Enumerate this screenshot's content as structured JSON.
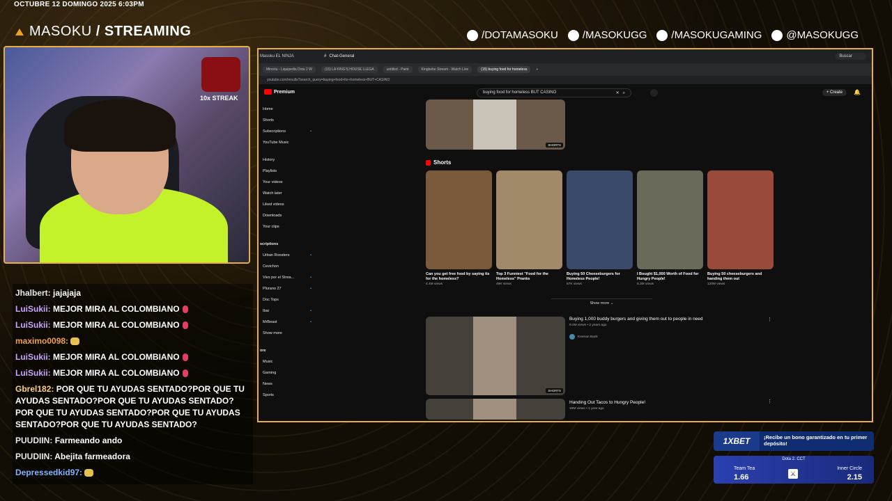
{
  "overlay": {
    "datetime": "OCTUBRE 12 DOMINGO 2025 6:03PM",
    "brand_name": "MASOKU",
    "brand_suffix": " / STREAMING",
    "socials": [
      {
        "icon": "facebook-icon",
        "label": "/DOTAMASOKU"
      },
      {
        "icon": "instagram-icon",
        "label": "/MASOKUGG"
      },
      {
        "icon": "youtube-icon",
        "label": "/MASOKUGAMING"
      },
      {
        "icon": "tiktok-icon",
        "label": "@MASOKUGG"
      }
    ],
    "streak": "10x STREAK"
  },
  "chat": [
    {
      "user": "Jhalbert:",
      "color": "#e8e8e8",
      "text": "jajajaja"
    },
    {
      "user": "LuiSukii:",
      "color": "#c8a6ff",
      "text": "MEJOR MIRA AL COLOMBIANO"
    },
    {
      "user": "LuiSukii:",
      "color": "#c8a6ff",
      "text": "MEJOR MIRA AL COLOMBIANO"
    },
    {
      "user": "maximo0098:",
      "color": "#f0a050",
      "text": ""
    },
    {
      "user": "LuiSukii:",
      "color": "#c8a6ff",
      "text": "MEJOR MIRA AL COLOMBIANO"
    },
    {
      "user": "LuiSukii:",
      "color": "#c8a6ff",
      "text": "MEJOR MIRA AL COLOMBIANO"
    },
    {
      "user": "Gbrel182:",
      "color": "#ffd080",
      "text": "POR QUE TU AYUDAS SENTADO?POR QUE TU AYUDAS SENTADO?POR QUE TU AYUDAS SENTADO?POR QUE TU AYUDAS SENTADO?POR QUE TU AYUDAS SENTADO?POR QUE TU AYUDAS SENTADO?"
    },
    {
      "user": "PUUDIIN:",
      "color": "#e8e8e8",
      "text": "Farmeando ando"
    },
    {
      "user": "PUUDIIN:",
      "color": "#e8e8e8",
      "text": "Abejita farmeadora"
    },
    {
      "user": "Depressedkid97:",
      "color": "#7fb2ff",
      "text": ""
    }
  ],
  "browser": {
    "window_title": "Masoku EL NINJA",
    "channel": "Chat-General",
    "tabs": [
      "Minoriu - Liquipedia Dota 2 W",
      "(15) LA KING'S HOUSE LLEGA",
      "untitled - Paint",
      "Kingbebe Stream - Watch Live",
      "(15) buying food for homeless"
    ],
    "search_placeholder": "Buscar",
    "url": "youtube.com/results?search_query=buying+food+for+homeless+BUT+CASINO"
  },
  "youtube": {
    "logo": "Premium",
    "query": "buying food for homeless BUT CASINO",
    "create_label": "Create",
    "sidebar": [
      {
        "label": "Home",
        "dot": false
      },
      {
        "label": "Shorts",
        "dot": false
      },
      {
        "label": "Subscriptions",
        "dot": true
      },
      {
        "label": "YouTube Music",
        "dot": false
      },
      {
        "gap": true
      },
      {
        "label": "History",
        "dot": false
      },
      {
        "label": "Playlists",
        "dot": false
      },
      {
        "label": "Your videos",
        "dot": false
      },
      {
        "label": "Watch later",
        "dot": false
      },
      {
        "label": "Liked videos",
        "dot": false
      },
      {
        "label": "Downloads",
        "dot": false
      },
      {
        "label": "Your clips",
        "dot": false
      },
      {
        "gap": true
      },
      {
        "label": "scriptions",
        "dot": false,
        "header": true
      },
      {
        "label": "Urban Roosters",
        "dot": true
      },
      {
        "label": "Cevichon",
        "dot": false
      },
      {
        "label": "Vivo por el Strea...",
        "dot": true
      },
      {
        "label": "Plurano 27",
        "dot": true
      },
      {
        "label": "Doc Tops",
        "dot": false
      },
      {
        "label": "Ibai",
        "dot": true
      },
      {
        "label": "MrBeast",
        "dot": true
      },
      {
        "label": "Show more",
        "dot": false
      },
      {
        "gap": true
      },
      {
        "label": "ore",
        "dot": false,
        "header": true
      },
      {
        "label": "Music",
        "dot": false
      },
      {
        "label": "Gaming",
        "dot": false
      },
      {
        "label": "News",
        "dot": false
      },
      {
        "label": "Sports",
        "dot": false
      }
    ],
    "shorts_title": "Shorts",
    "shorts_badge": "SHORTS",
    "shorts": [
      {
        "title": "Can you get free food by saying its for the homeless?",
        "views": "4.4M views",
        "color": "#7a5a3a"
      },
      {
        "title": "Top 3 Funniest \"Food for the Homeless\" Pranks",
        "views": "49K views",
        "color": "#a08a6a"
      },
      {
        "title": "Buying 50 Cheeseburgers for Homeless People!",
        "views": "87K views",
        "color": "#3a4a6a"
      },
      {
        "title": "I Bought $1,000 Worth of Food for Hungry People!",
        "views": "5.3M views",
        "color": "#6a6a5a"
      },
      {
        "title": "Buying 50 cheeseburgers and handing them out",
        "views": "120M views",
        "color": "#9a4a3a"
      }
    ],
    "show_more": "Show more",
    "videos": [
      {
        "title": "Buying 1,000 buddy burgers and giving them out to people in need",
        "sub": "9.4M views • 2 years ago",
        "channel": "Keenan Bank"
      },
      {
        "title": "Handing Out Tacos to Hungry People!",
        "sub": "18M views • 1 year ago",
        "channel": ""
      }
    ]
  },
  "betting": {
    "brand": "1XBET",
    "promo": "¡Recibe un bono garantizado en tu primer depósito!",
    "league": "Dota 2. CCT",
    "team_a": "Team Tea",
    "odds_a": "1.66",
    "team_b": "Inner Circle",
    "odds_b": "2.15"
  }
}
